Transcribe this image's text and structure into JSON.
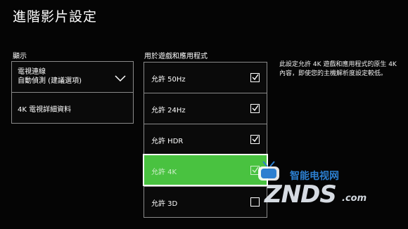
{
  "page": {
    "title": "進階影片設定"
  },
  "display": {
    "label": "顯示",
    "dropdown": {
      "line1": "電視連線",
      "line2": "自動偵測 (建議選項)"
    },
    "details_button": "4K 電視詳細資料"
  },
  "games_apps": {
    "label": "用於遊戲和應用程式",
    "options": [
      {
        "label": "允許 50Hz",
        "checked": true
      },
      {
        "label": "允許 24Hz",
        "checked": true
      },
      {
        "label": "允許 HDR",
        "checked": true
      },
      {
        "label": "允許 4K",
        "checked": true,
        "selected": true
      },
      {
        "label": "允許 3D",
        "checked": false
      }
    ]
  },
  "description": "此設定允許 4K 遊戲和應用程式的原生 4K 內容，即使您的主機解析度設定較低。",
  "watermark": {
    "top": "智能电视网",
    "main": "ZNDS",
    "suffix": ".com"
  },
  "colors": {
    "accent": "#49c240",
    "background": "#050505",
    "border": "#8a8a8a"
  }
}
